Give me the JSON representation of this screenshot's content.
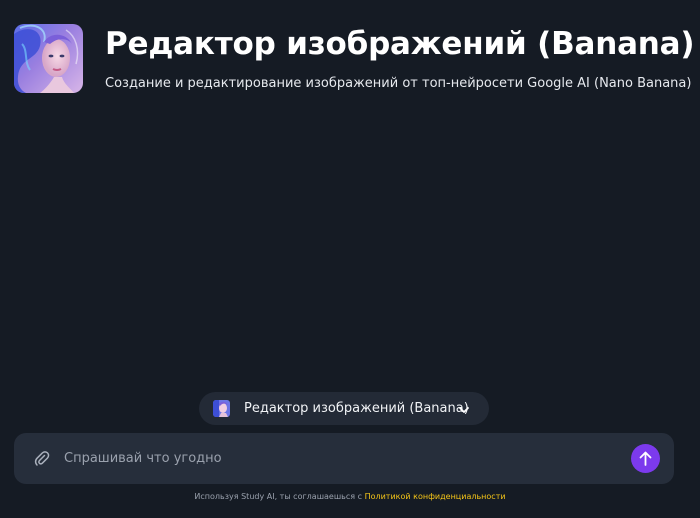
{
  "header": {
    "title": "Редактор изображений (Banana)",
    "subtitle": "Создание и редактирование изображений от топ-нейросети Google AI (Nano Banana)",
    "avatar_icon": "portrait-art-image"
  },
  "model_selector": {
    "label": "Редактор изображений (Banana)",
    "icon": "portrait-art-image",
    "chevron_icon": "chevron-down-icon"
  },
  "composer": {
    "placeholder": "Спрашивай что угодно",
    "value": "",
    "attach_icon": "paperclip-icon",
    "send_icon": "arrow-up-icon"
  },
  "footer": {
    "text": "Используя Study AI, ты соглашаешься с ",
    "link": "Политикой конфиденциальности"
  },
  "colors": {
    "background": "#151b24",
    "surface": "#262e3b",
    "selector": "#232a36",
    "accent": "#7c3aed",
    "link": "#f5c518"
  }
}
